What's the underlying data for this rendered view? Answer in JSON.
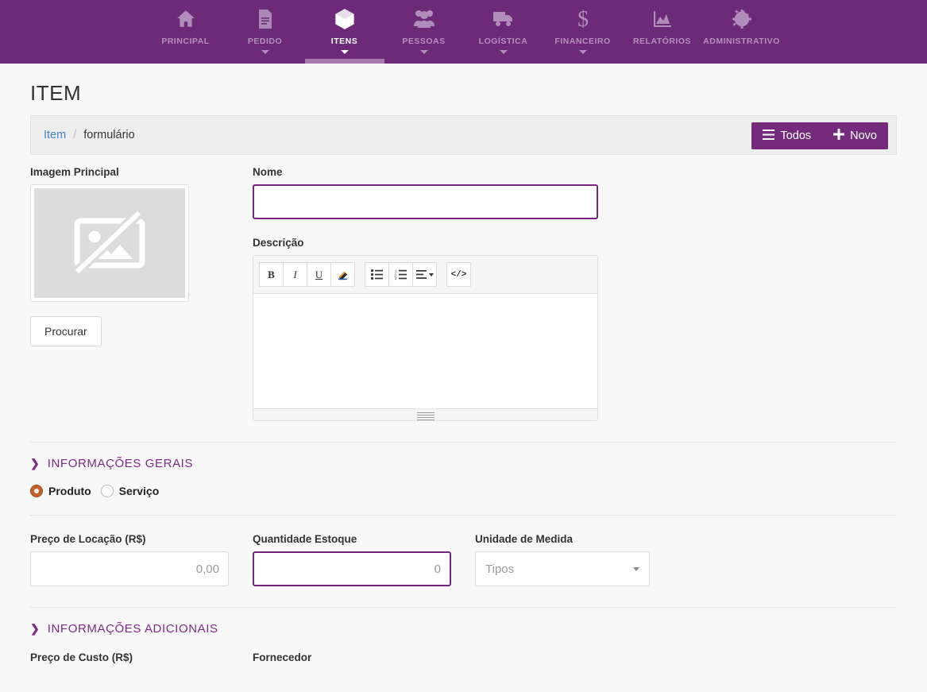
{
  "nav": {
    "items": [
      {
        "label": "PRINCIPAL",
        "icon": "home-icon",
        "active": false,
        "caret": false
      },
      {
        "label": "PEDIDO",
        "icon": "document-icon",
        "active": false,
        "caret": true
      },
      {
        "label": "ITENS",
        "icon": "cube-icon",
        "active": true,
        "caret": true
      },
      {
        "label": "PESSOAS",
        "icon": "people-icon",
        "active": false,
        "caret": true
      },
      {
        "label": "LOGÍSTICA",
        "icon": "truck-icon",
        "active": false,
        "caret": true
      },
      {
        "label": "FINANCEIRO",
        "icon": "dollar-icon",
        "active": false,
        "caret": true
      },
      {
        "label": "RELATÓRIOS",
        "icon": "chart-icon",
        "active": false,
        "caret": false
      },
      {
        "label": "ADMINISTRATIVO",
        "icon": "gear-icon",
        "active": false,
        "caret": false
      }
    ]
  },
  "page": {
    "title": "ITEM"
  },
  "breadcrumb": {
    "root": "Item",
    "separator": "/",
    "current": "formulário"
  },
  "actions": {
    "todos_label": "Todos",
    "todos_icon": "hamburger-icon",
    "novo_label": "Novo",
    "novo_icon": "plus-icon"
  },
  "form": {
    "image": {
      "label": "Imagem Principal",
      "placeholder_icon": "broken-image-icon",
      "browse_label": "Procurar"
    },
    "nome": {
      "label": "Nome",
      "value": "",
      "placeholder": "",
      "required": true
    },
    "descricao": {
      "label": "Descrição",
      "value": "",
      "toolbar": [
        {
          "name": "bold-icon",
          "glyph": "B"
        },
        {
          "name": "italic-icon",
          "glyph": "I"
        },
        {
          "name": "underline-icon",
          "glyph": "U"
        },
        {
          "name": "eraser-icon",
          "glyph": "◨"
        },
        {
          "name": "unordered-list-icon",
          "glyph": "☰"
        },
        {
          "name": "ordered-list-icon",
          "glyph": "☷"
        },
        {
          "name": "align-icon",
          "glyph": "≡"
        },
        {
          "name": "code-view-icon",
          "glyph": "</>"
        }
      ]
    }
  },
  "sections": {
    "gerais": {
      "title": "INFORMAÇÕES GERAIS",
      "chevron": "❯"
    },
    "adicionais": {
      "title": "INFORMAÇÕES ADICIONAIS",
      "chevron": "❯"
    }
  },
  "tipo": {
    "options": [
      {
        "label": "Produto",
        "selected": true
      },
      {
        "label": "Serviço",
        "selected": false
      }
    ]
  },
  "gerais_fields": {
    "preco_locacao": {
      "label": "Preço de Locação (R$)",
      "value": "",
      "placeholder": "0,00",
      "required": false
    },
    "quantidade_estoque": {
      "label": "Quantidade Estoque",
      "value": "",
      "placeholder": "0",
      "required": true
    },
    "unidade_medida": {
      "label": "Unidade de Medida",
      "selected": "Tipos"
    }
  },
  "adicionais_fields": {
    "preco_custo": {
      "label": "Preço de Custo (R$)"
    },
    "fornecedor": {
      "label": "Fornecedor"
    }
  },
  "colors": {
    "nav_bg": "#6d2a78",
    "button_purple": "#742b7c",
    "active_underline": "#a878ac",
    "section_purple": "#7e2a86",
    "required_border": "#74247c",
    "link_blue": "#4183c4",
    "radio_on": "#c0622a",
    "page_bg": "#f8f8f8"
  }
}
